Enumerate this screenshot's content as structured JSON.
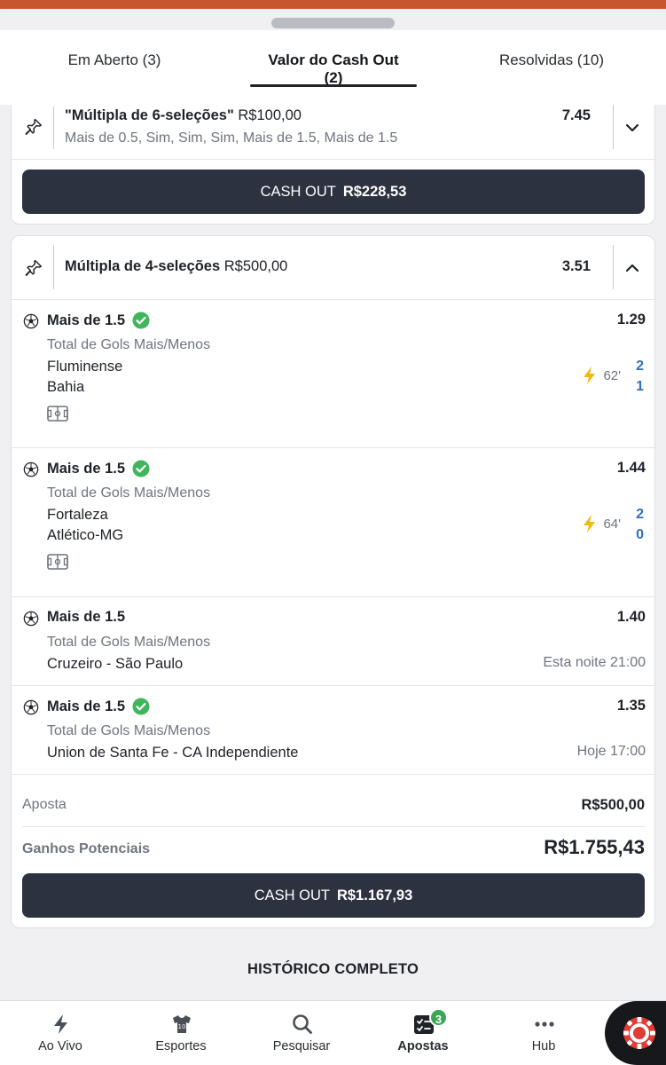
{
  "tabs": [
    {
      "label": "Em Aberto (3)"
    },
    {
      "label": "Valor do Cash Out (2)"
    },
    {
      "label": "Resolvidas (10)"
    }
  ],
  "bet1": {
    "title": "\"Múltipla de 6-seleções\"",
    "stake": "R$100,00",
    "selections_summary": "Mais de 0.5, Sim, Sim, Sim, Mais de 1.5, Mais de 1.5",
    "odds": "7.45",
    "cashout_label": "CASH OUT",
    "cashout_amount": "R$228,53"
  },
  "bet2": {
    "title": "Múltipla de 4-seleções",
    "stake": "R$500,00",
    "odds": "3.51",
    "selections": [
      {
        "pick": "Mais de 1.5",
        "odds": "1.29",
        "market": "Total de Gols Mais/Menos",
        "home": "Fluminense",
        "away": "Bahia",
        "minute": "62'",
        "home_score": "2",
        "away_score": "1"
      },
      {
        "pick": "Mais de 1.5",
        "odds": "1.44",
        "market": "Total de Gols Mais/Menos",
        "home": "Fortaleza",
        "away": "Atlético-MG",
        "minute": "64'",
        "home_score": "2",
        "away_score": "0"
      },
      {
        "pick": "Mais de 1.5",
        "odds": "1.40",
        "market": "Total de Gols Mais/Menos",
        "match": "Cruzeiro - São Paulo",
        "time": "Esta noite 21:00"
      },
      {
        "pick": "Mais de 1.5",
        "odds": "1.35",
        "market": "Total de Gols Mais/Menos",
        "match": "Union de Santa Fe - CA Independiente",
        "time": "Hoje 17:00"
      }
    ],
    "aposta_label": "Aposta",
    "aposta_value": "R$500,00",
    "ganhos_label": "Ganhos Potenciais",
    "ganhos_value": "R$1.755,43",
    "cashout_label": "CASH OUT",
    "cashout_amount": "R$1.167,93"
  },
  "history_label": "HISTÓRICO COMPLETO",
  "nav": [
    {
      "label": "Ao Vivo",
      "icon": "lightning-icon"
    },
    {
      "label": "Esportes",
      "icon": "jersey-icon"
    },
    {
      "label": "Pesquisar",
      "icon": "search-icon"
    },
    {
      "label": "Apostas",
      "icon": "betslip-icon",
      "badge": "3"
    },
    {
      "label": "Hub",
      "icon": "dots-icon"
    }
  ],
  "colors": {
    "accent_blue": "#2f6fbf",
    "button_dark": "#2c3240",
    "check_green": "#3fb65b",
    "live_yellow": "#f2b90f",
    "top_orange": "#c8562b"
  }
}
